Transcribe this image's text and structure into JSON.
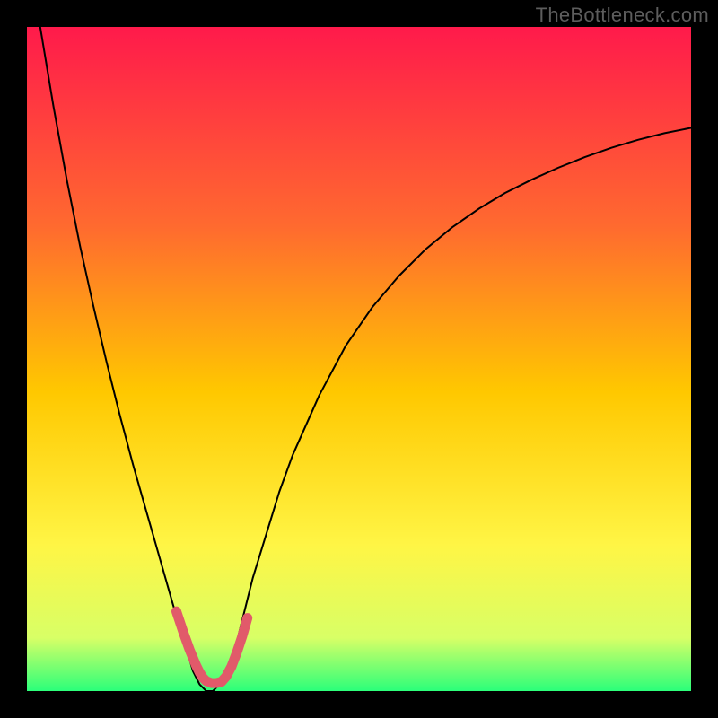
{
  "attribution": "TheBottleneck.com",
  "chart_data": {
    "type": "line",
    "title": "",
    "xlabel": "",
    "ylabel": "",
    "xlim": [
      0,
      1
    ],
    "ylim": [
      0,
      1
    ],
    "background_gradient": {
      "direction": "vertical",
      "stops": [
        {
          "pos": 0.0,
          "color": "#ff1a4b"
        },
        {
          "pos": 0.3,
          "color": "#ff6a2f"
        },
        {
          "pos": 0.55,
          "color": "#ffc800"
        },
        {
          "pos": 0.78,
          "color": "#fff545"
        },
        {
          "pos": 0.92,
          "color": "#d8ff66"
        },
        {
          "pos": 1.0,
          "color": "#2bff7a"
        }
      ]
    },
    "series": [
      {
        "name": "bottleneck-curve",
        "stroke": "#000000",
        "stroke_width": 2,
        "x": [
          0.02,
          0.04,
          0.06,
          0.08,
          0.1,
          0.12,
          0.14,
          0.16,
          0.18,
          0.2,
          0.22,
          0.24,
          0.25,
          0.26,
          0.27,
          0.28,
          0.29,
          0.3,
          0.31,
          0.32,
          0.33,
          0.34,
          0.36,
          0.38,
          0.4,
          0.44,
          0.48,
          0.52,
          0.56,
          0.6,
          0.64,
          0.68,
          0.72,
          0.76,
          0.8,
          0.84,
          0.88,
          0.92,
          0.96,
          1.0
        ],
        "y": [
          1.0,
          0.88,
          0.77,
          0.67,
          0.58,
          0.495,
          0.415,
          0.34,
          0.27,
          0.2,
          0.13,
          0.065,
          0.03,
          0.01,
          0.0,
          0.0,
          0.01,
          0.025,
          0.05,
          0.09,
          0.13,
          0.17,
          0.235,
          0.3,
          0.355,
          0.445,
          0.52,
          0.578,
          0.625,
          0.665,
          0.698,
          0.726,
          0.75,
          0.77,
          0.788,
          0.804,
          0.818,
          0.83,
          0.84,
          0.848
        ]
      },
      {
        "name": "optimal-marker",
        "stroke": "#e15a6a",
        "stroke_width": 11,
        "x": [
          0.225,
          0.235,
          0.245,
          0.255,
          0.26,
          0.265,
          0.27,
          0.278,
          0.285,
          0.293,
          0.3,
          0.308,
          0.316,
          0.324,
          0.332
        ],
        "y": [
          0.12,
          0.09,
          0.062,
          0.038,
          0.028,
          0.02,
          0.015,
          0.012,
          0.012,
          0.014,
          0.022,
          0.037,
          0.058,
          0.082,
          0.11
        ]
      }
    ]
  }
}
